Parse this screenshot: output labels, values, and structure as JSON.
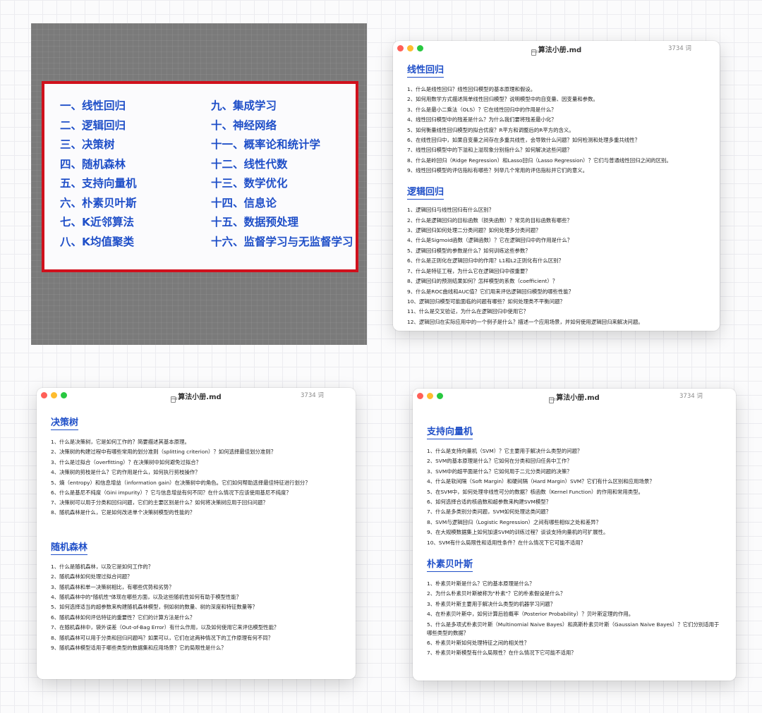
{
  "toc": {
    "left": [
      "一、线性回归",
      "二、逻辑回归",
      "三、决策树",
      "四、随机森林",
      "五、支持向量机",
      "六、朴素贝叶斯",
      "七、K近邻算法",
      "八、K均值聚类"
    ],
    "right": [
      "九、集成学习",
      "十、神经网络",
      "十一、概率论和统计学",
      "十二、线性代数",
      "十三、数学优化",
      "十四、信息论",
      "十五、数据预处理",
      "十六、监督学习与无监督学习"
    ]
  },
  "windows": [
    {
      "title": "算法小册.md",
      "icon_glyph": "md",
      "word_count": "3734 词",
      "sections": [
        {
          "heading": "线性回归",
          "questions": [
            "1、什么是线性回归？线性回归模型的基本原理和假设。",
            "2、如何用数学方式描述简单线性回归模型？说明模型中的自变量、因变量和参数。",
            "3、什么是最小二乘法（OLS）？它在线性回归中的作用是什么？",
            "4、线性回归模型中的残差是什么？为什么我们要将残差最小化？",
            "5、如何衡量线性回归模型的拟合优度？R平方和调整后的R平方的含义。",
            "6、在线性回归中，如果自变量之间存在多重共线性，会导致什么问题？如何检测和处理多重共线性？",
            "7、线性回归模型中的下溢和上溢现象分别指什么？如何解决这些问题？",
            "8、什么是岭回归（Ridge Regression）和Lasso回归（Lasso Regression）？它们与普通线性回归之间的区别。",
            "9、线性回归模型的评估指标有哪些？列举几个常用的评估指标并它们的意义。"
          ]
        },
        {
          "heading": "逻辑回归",
          "questions": [
            "1、逻辑回归与线性回归有什么区别？",
            "2、什么是逻辑回归的目标函数（损失函数）？常见的目标函数有哪些？",
            "3、逻辑回归如何处理二分类问题？如何处理多分类问题？",
            "4、什么是Sigmoid函数（逻辑函数）？它在逻辑回归中的作用是什么？",
            "5、逻辑回归模型的参数是什么？如何训练这些参数？",
            "6、什么是正则化在逻辑回归中的作用？L1和L2正则化有什么区别？",
            "7、什么是特征工程，为什么它在逻辑回归中很重要？",
            "8、逻辑回归的预测结果如何？怎样模型的系数（coefficient）？",
            "9、什么是ROC曲线和AUC值？它们用来评估逻辑回归模型的哪些性能？",
            "10、逻辑回归模型可能面临的问题有哪些？如何处理类不平衡问题？",
            "11、什么是交叉验证，为什么在逻辑回归中使用它？",
            "12、逻辑回归在实际应用中的一个例子是什么？描述一个应用场景，并如何使用逻辑回归来解决问题。"
          ]
        }
      ]
    },
    {
      "title": "算法小册.md",
      "icon_glyph": "md",
      "word_count": "3734 词",
      "sections": [
        {
          "heading": "决策树",
          "questions": [
            "1、什么是决策树，它是如何工作的？简要描述其基本原理。",
            "2、决策树的构建过程中有哪些常用的划分准则（splitting criterion）？如何选择最佳划分准则？",
            "3、什么是过拟合（overfitting）？在决策树中如何避免过拟合？",
            "4、决策树的剪枝是什么？它的作用是什么，如何执行剪枝操作？",
            "5、熵（entropy）和信息增益（information gain）在决策树中的角色。它们如何帮助选择最佳特征进行划分？",
            "6、什么是基尼不纯度（Gini impurity）？它与信息增益有何不同？在什么情况下应该使用基尼不纯度？",
            "7、决策树可以用于分类和回归问题，它们的主要区别是什么？如何将决策树应用于回归问题？",
            "8、随机森林是什么，它是如何改进单个决策树模型的性能的？"
          ]
        },
        {
          "heading": "随机森林",
          "questions": [
            "1、什么是随机森林，以及它是如何工作的？",
            "2、随机森林如何处理过拟合问题？",
            "3、随机森林和单一决策树相比，有哪些优势和劣势？",
            "4、随机森林中的\"随机性\"体现在哪些方面，以及这些随机性如何有助于模型性能？",
            "5、如何选择适当的超参数来构建随机森林模型，例如树的数量、树的深度和特征数量等？",
            "6、随机森林如何评估特征的重要性？它们的计算方法是什么？",
            "7、在随机森林中，袋外误差（Out-of-Bag Error）有什么作用，以及如何使用它来评估模型性能？",
            "8、随机森林可以用于分类和回归问题吗？如果可以，它们在这两种情况下的工作原理有何不同？",
            "9、随机森林模型适用于哪些类型的数据集和应用场景？它的局限性是什么？"
          ]
        }
      ]
    },
    {
      "title": "算法小册.md",
      "icon_glyph": "md",
      "word_count": "3734 词",
      "sections": [
        {
          "heading": "支持向量机",
          "questions": [
            "1、什么是支持向量机（SVM）？它主要用于解决什么类型的问题？",
            "2、SVM的基本原理是什么？它如何在分类和回归任务中工作？",
            "3、SVM中的超平面是什么？它如何用于二元分类问题的决策？",
            "4、什么是软间隔（Soft Margin）和硬间隔（Hard Margin）SVM？它们有什么区别和应用场景？",
            "5、在SVM中，如何处理非线性可分的数据？核函数（Kernel Function）的作用和常用类型。",
            "6、如何选择合适的核函数和超参数来构建SVM模型？",
            "7、什么是多类别分类问题，SVM如何处理这类问题？",
            "8、SVM与逻辑回归（Logistic Regression）之间有哪些相似之处和差异？",
            "9、在大规模数据集上如何加速SVM的训练过程？谈谈支持向量机的可扩展性。",
            "10、SVM有什么局限性和适用性条件？在什么情况下它可能不适用？"
          ]
        },
        {
          "heading": "朴素贝叶斯",
          "questions": [
            "1、朴素贝叶斯是什么？它的基本原理是什么？",
            "2、为什么朴素贝叶斯被称为\"朴素\"？它的朴素假设是什么？",
            "3、朴素贝叶斯主要用于解决什么类型的机器学习问题？",
            "4、在朴素贝叶斯中，如何计算后验概率（Posterior Probability）？贝叶斯定理的作用。",
            "5、什么是多项式朴素贝叶斯（Multinomial Naive Bayes）和高斯朴素贝叶斯（Gaussian Naive Bayes）？它们分别适用于哪些类型的数据？",
            "6、朴素贝叶斯如何处理特征之间的相关性？",
            "7、朴素贝叶斯模型有什么局限性？在什么情况下它可能不适用？"
          ]
        }
      ]
    }
  ]
}
